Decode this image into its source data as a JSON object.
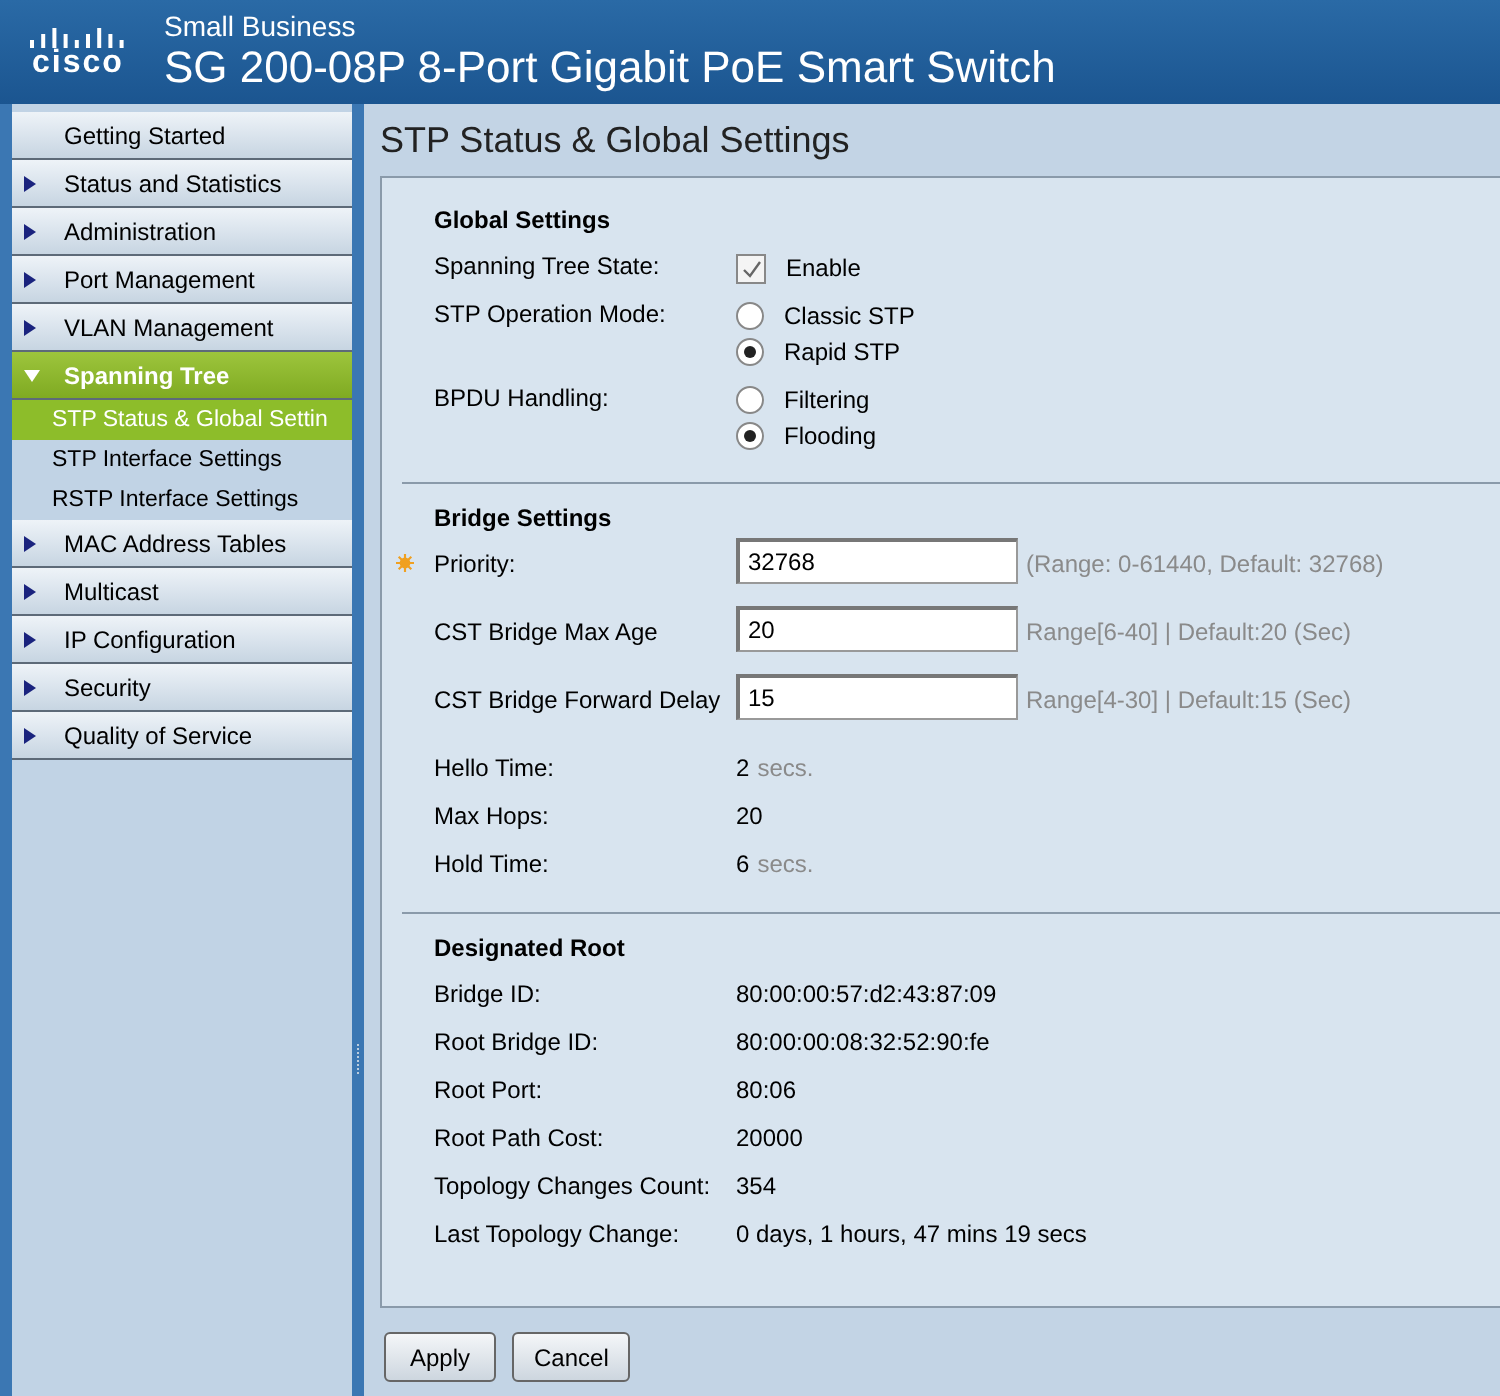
{
  "header": {
    "logo_text": "cisco",
    "subtitle": "Small Business",
    "title": "SG 200-08P 8-Port Gigabit PoE Smart Switch"
  },
  "nav": [
    {
      "label": "Getting Started",
      "kind": "link",
      "selected": false
    },
    {
      "label": "Status and Statistics",
      "kind": "folder",
      "expanded": false,
      "selected": false
    },
    {
      "label": "Administration",
      "kind": "folder",
      "expanded": false,
      "selected": false
    },
    {
      "label": "Port Management",
      "kind": "folder",
      "expanded": false,
      "selected": false
    },
    {
      "label": "VLAN Management",
      "kind": "folder",
      "expanded": false,
      "selected": false
    },
    {
      "label": "Spanning Tree",
      "kind": "folder",
      "expanded": true,
      "selected": true,
      "children": [
        {
          "label": "STP Status & Global Settin",
          "selected": true
        },
        {
          "label": "STP Interface Settings",
          "selected": false
        },
        {
          "label": "RSTP Interface Settings",
          "selected": false
        }
      ]
    },
    {
      "label": "MAC Address Tables",
      "kind": "folder",
      "expanded": false,
      "selected": false
    },
    {
      "label": "Multicast",
      "kind": "folder",
      "expanded": false,
      "selected": false
    },
    {
      "label": "IP Configuration",
      "kind": "folder",
      "expanded": false,
      "selected": false
    },
    {
      "label": "Security",
      "kind": "folder",
      "expanded": false,
      "selected": false
    },
    {
      "label": "Quality of Service",
      "kind": "folder",
      "expanded": false,
      "selected": false
    }
  ],
  "page_title": "STP Status & Global Settings",
  "sections": [
    {
      "title": "Global Settings",
      "rows": [
        {
          "kind": "checkbox",
          "label": "Spanning Tree State:",
          "option": "Enable",
          "checked": true
        },
        {
          "kind": "radio",
          "label": "STP Operation Mode:",
          "options": [
            {
              "label": "Classic STP",
              "selected": false
            },
            {
              "label": "Rapid STP",
              "selected": true
            }
          ]
        },
        {
          "kind": "radio",
          "label": "BPDU Handling:",
          "options": [
            {
              "label": "Filtering",
              "selected": false
            },
            {
              "label": "Flooding",
              "selected": true
            }
          ]
        }
      ]
    },
    {
      "title": "Bridge Settings",
      "rows": [
        {
          "kind": "input",
          "label": "Priority:",
          "required": true,
          "value": "32768",
          "hint": "(Range: 0-61440, Default: 32768)"
        },
        {
          "kind": "input",
          "label": "CST Bridge Max Age",
          "required": false,
          "value": "20",
          "hint": "Range[6-40] | Default:20 (Sec)"
        },
        {
          "kind": "input",
          "label": "CST Bridge Forward Delay",
          "required": false,
          "value": "15",
          "hint": "Range[4-30] | Default:15 (Sec)"
        },
        {
          "kind": "text",
          "label": "Hello Time:",
          "value": "2",
          "unit": "secs."
        },
        {
          "kind": "text",
          "label": "Max Hops:",
          "value": "20"
        },
        {
          "kind": "text",
          "label": "Hold Time:",
          "value": "6",
          "unit": "secs."
        }
      ]
    },
    {
      "title": "Designated Root",
      "rows": [
        {
          "kind": "text",
          "label": "Bridge ID:",
          "value": "80:00:00:57:d2:43:87:09"
        },
        {
          "kind": "text",
          "label": "Root Bridge ID:",
          "value": "80:00:00:08:32:52:90:fe"
        },
        {
          "kind": "text",
          "label": "Root Port:",
          "value": "80:06"
        },
        {
          "kind": "text",
          "label": "Root Path Cost:",
          "value": "20000"
        },
        {
          "kind": "text",
          "label": "Topology Changes Count:",
          "value": "354"
        },
        {
          "kind": "text",
          "label": "Last Topology Change:",
          "value": "0 days, 1 hours, 47 mins 19 secs"
        }
      ]
    }
  ],
  "buttons": [
    "Apply",
    "Cancel"
  ]
}
